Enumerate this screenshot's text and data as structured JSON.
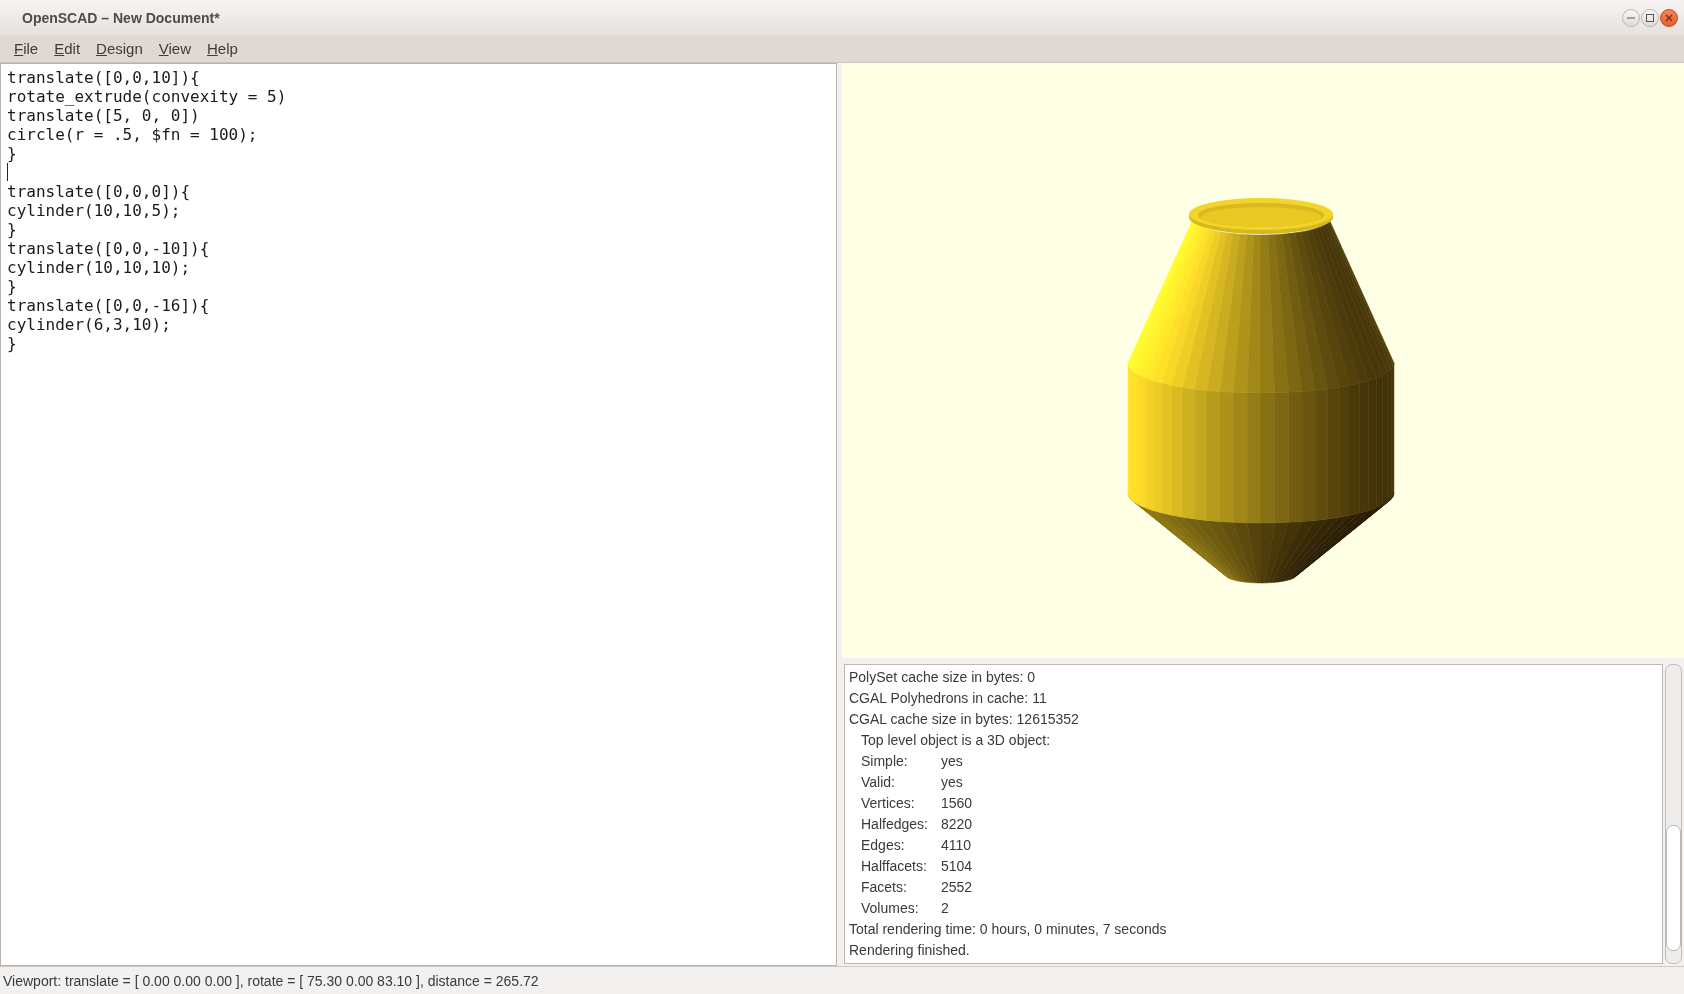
{
  "window": {
    "title": "OpenSCAD – New Document*"
  },
  "menu": [
    "File",
    "Edit",
    "Design",
    "View",
    "Help"
  ],
  "editor": {
    "lines": [
      {
        "text": "translate([0,0,10]){",
        "caret": false
      },
      {
        "text": "rotate_extrude(convexity = 5)",
        "caret": false
      },
      {
        "text": "translate([5, 0, 0])",
        "caret": false
      },
      {
        "text": "circle(r = .5, $fn = 100);",
        "caret": false
      },
      {
        "text": "}",
        "caret": false
      },
      {
        "caret": true
      },
      {
        "text": "translate([0,0,0]){",
        "caret": false
      },
      {
        "text": "cylinder(10,10,5);",
        "caret": false
      },
      {
        "text": "}",
        "caret": false
      },
      {
        "text": "translate([0,0,-10]){",
        "caret": false
      },
      {
        "text": "cylinder(10,10,10);",
        "caret": false
      },
      {
        "text": "}",
        "caret": false
      },
      {
        "text": "translate([0,0,-16]){",
        "caret": false
      },
      {
        "text": "cylinder(6,3,10);",
        "caret": false
      },
      {
        "text": "}",
        "caret": false
      }
    ]
  },
  "console": {
    "lines": [
      {
        "kind": "plain",
        "text": "PolySet cache size in bytes: 0"
      },
      {
        "kind": "plain",
        "text": "CGAL Polyhedrons in cache: 11"
      },
      {
        "kind": "plain",
        "text": "CGAL cache size in bytes: 12615352"
      },
      {
        "kind": "indented",
        "text": "Top level object is a 3D object:"
      },
      {
        "kind": "pair",
        "label": "Simple:",
        "value": "yes"
      },
      {
        "kind": "pair",
        "label": "Valid:",
        "value": "yes"
      },
      {
        "kind": "pair",
        "label": "Vertices:",
        "value": "1560"
      },
      {
        "kind": "pair",
        "label": "Halfedges:",
        "value": "8220"
      },
      {
        "kind": "pair",
        "label": "Edges:",
        "value": "4110"
      },
      {
        "kind": "pair",
        "label": "Halffacets:",
        "value": "5104"
      },
      {
        "kind": "pair",
        "label": "Facets:",
        "value": "2552"
      },
      {
        "kind": "pair",
        "label": "Volumes:",
        "value": "2"
      },
      {
        "kind": "plain",
        "text": "Total rendering time: 0 hours, 0 minutes, 7 seconds"
      },
      {
        "kind": "plain",
        "text": "Rendering finished."
      }
    ]
  },
  "status_bar": {
    "text": "Viewport: translate = [ 0.00 0.00 0.00 ], rotate = [ 75.30 0.00 83.10 ], distance = 265.72"
  }
}
